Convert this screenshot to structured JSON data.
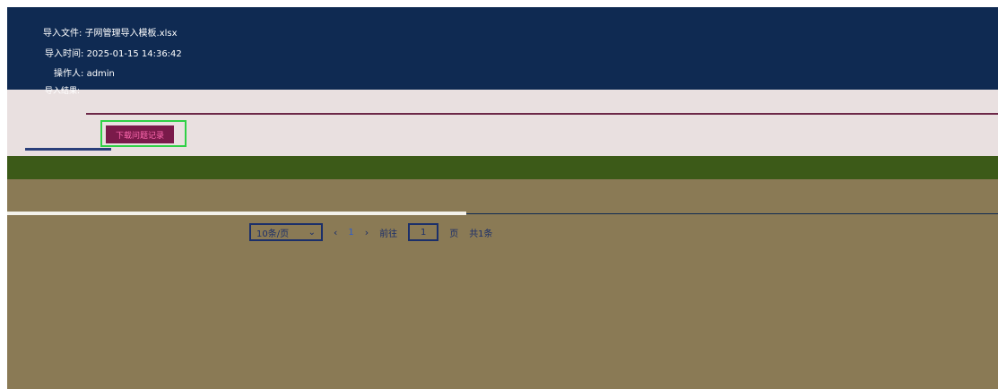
{
  "import_info": {
    "file_label": "导入文件:",
    "file_value": "子网管理导入模板.xlsx",
    "time_label": "导入时间:",
    "time_value": "2025-01-15 14:36:42",
    "operator_label": "操作人:",
    "operator_value": "admin",
    "result_label": "导入结果:"
  },
  "actions": {
    "download_label": "下载问题记录"
  },
  "pagination": {
    "page_size_label": "10条/页",
    "current_page": "1",
    "goto_label": "前往",
    "goto_value": "1",
    "page_suffix": "页",
    "total_label": "共1条"
  },
  "colors": {
    "header_bg": "#0f2a52",
    "panel_bg": "#8a7a55",
    "accent_green": "#2fd045",
    "button_bg": "#7a1a4a",
    "table_head_bg": "#3c5a18"
  }
}
